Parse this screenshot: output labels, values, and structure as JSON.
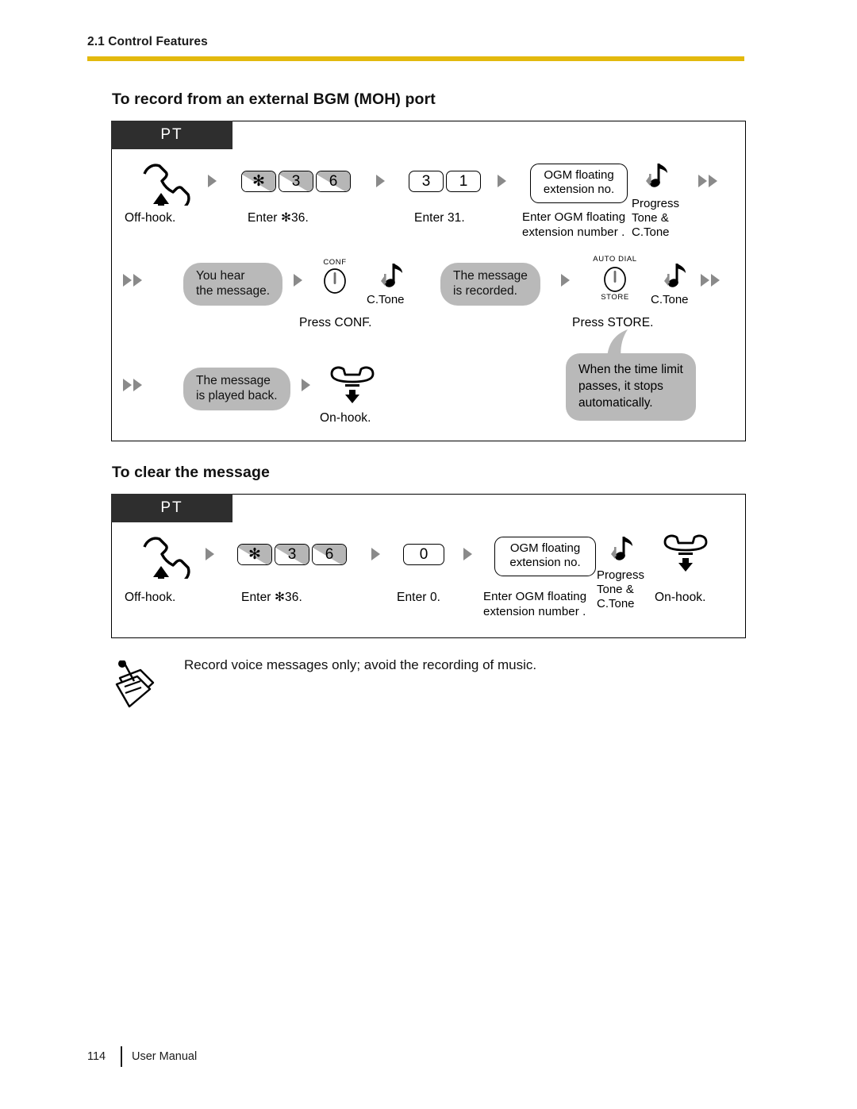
{
  "header": {
    "section": "2.1 Control Features",
    "rule_color": "#e3b90d"
  },
  "sections": [
    {
      "id": "record",
      "title": "To record from an external BGM (MOH) port",
      "device_tag": "PT"
    },
    {
      "id": "clear",
      "title": "To clear the message",
      "device_tag": "PT"
    }
  ],
  "flow_record": {
    "row1": {
      "offhook_caption": "Off-hook.",
      "keys_feature": [
        "✻",
        "3",
        "6"
      ],
      "keys_feature_caption": "Enter ✻36.",
      "keys_number": [
        "3",
        "1"
      ],
      "keys_number_caption": "Enter 31.",
      "ogm_box_line1": "OGM floating",
      "ogm_box_line2": "extension no.",
      "ogm_caption_line1": "Enter OGM floating",
      "ogm_caption_line2": "extension number  .",
      "tone_line1": "Progress",
      "tone_line2": "Tone &",
      "tone_line3": "C.Tone"
    },
    "row2": {
      "pill_hear_line1": "You hear",
      "pill_hear_line2": "the message.",
      "conf_button_label": "CONF",
      "conf_tone": "C.Tone",
      "conf_caption": "Press CONF.",
      "pill_recorded_line1": "The message",
      "pill_recorded_line2": "is recorded.",
      "store_button_label_top": "AUTO DIAL",
      "store_button_label_bottom": "STORE",
      "store_tone": "C.Tone",
      "store_caption": "Press STORE."
    },
    "row3": {
      "pill_played_line1": "The message",
      "pill_played_line2": "is played back.",
      "onhook_caption": "On-hook.",
      "balloon_line1": "When the time limit",
      "balloon_line2": "passes, it stops",
      "balloon_line3": "automatically."
    }
  },
  "flow_clear": {
    "offhook_caption": "Off-hook.",
    "keys_feature": [
      "✻",
      "3",
      "6"
    ],
    "keys_feature_caption": "Enter  ✻36.",
    "keys_number": [
      "0"
    ],
    "keys_number_caption": "Enter 0.",
    "ogm_box_line1": "OGM floating",
    "ogm_box_line2": "extension no.",
    "ogm_caption_line1": "Enter OGM floating",
    "ogm_caption_line2": "extension number  .",
    "tone_line1": "Progress",
    "tone_line2": "Tone &",
    "tone_line3": "C.Tone",
    "onhook_caption": "On-hook."
  },
  "note": {
    "icon": "note-pad-icon",
    "text": "Record voice messages only; avoid the recording of music."
  },
  "footer": {
    "page_number": "114",
    "label": "User Manual"
  }
}
